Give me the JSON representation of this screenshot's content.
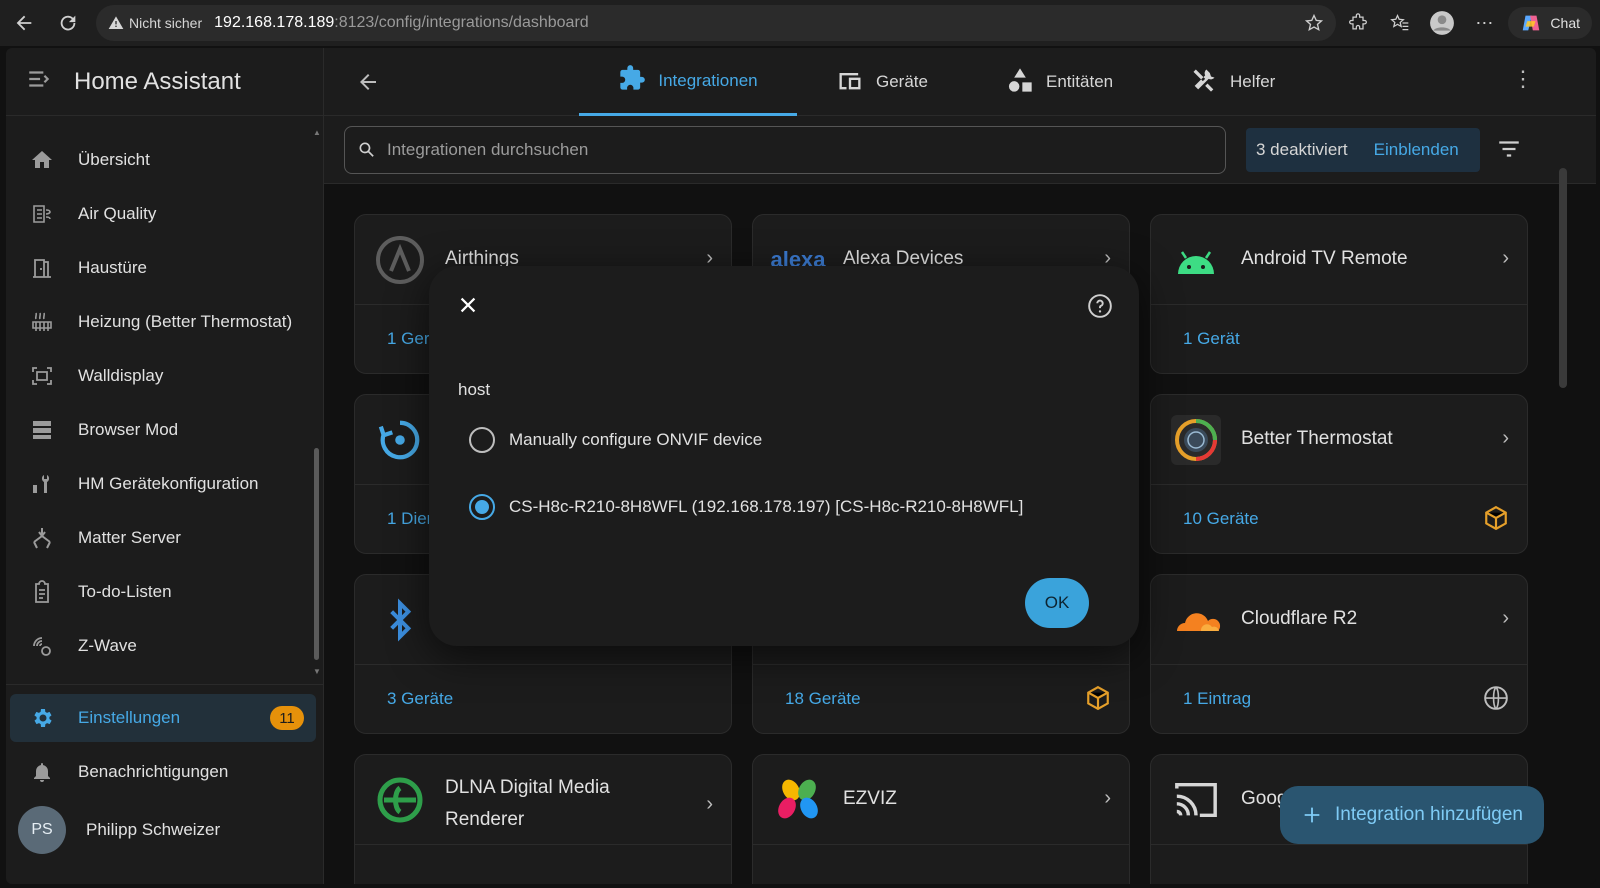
{
  "browser": {
    "not_secure": "Nicht sicher",
    "url_host": "192.168.178.189",
    "url_path": ":8123/config/integrations/dashboard",
    "chat": "Chat"
  },
  "sidebar": {
    "title": "Home Assistant",
    "items": [
      {
        "label": "Übersicht",
        "icon": "home-icon"
      },
      {
        "label": "Air Quality",
        "icon": "air-quality-icon"
      },
      {
        "label": "Haustüre",
        "icon": "door-icon"
      },
      {
        "label": "Heizung (Better Thermostat)",
        "icon": "radiator-icon"
      },
      {
        "label": "Walldisplay",
        "icon": "display-icon"
      },
      {
        "label": "Browser Mod",
        "icon": "server-icon"
      },
      {
        "label": "HM Gerätekonfiguration",
        "icon": "tools-icon"
      },
      {
        "label": "Matter Server",
        "icon": "matter-icon"
      },
      {
        "label": "To-do-Listen",
        "icon": "clipboard-icon"
      },
      {
        "label": "Z-Wave",
        "icon": "zwave-icon"
      }
    ],
    "settings": {
      "label": "Einstellungen",
      "badge": "11"
    },
    "notifications": "Benachrichtigungen",
    "user": {
      "initials": "PS",
      "name": "Philipp Schweizer"
    }
  },
  "tabs": [
    {
      "label": "Integrationen",
      "icon": "puzzle-icon"
    },
    {
      "label": "Geräte",
      "icon": "devices-icon"
    },
    {
      "label": "Entitäten",
      "icon": "shapes-icon"
    },
    {
      "label": "Helfer",
      "icon": "tools-icon"
    }
  ],
  "search": {
    "placeholder": "Integrationen durchsuchen",
    "disabled_count": "3 deaktiviert",
    "show": "Einblenden"
  },
  "cards": [
    {
      "name": "Airthings",
      "foot": "1 Gerä"
    },
    {
      "name": "Alexa Devices",
      "foot": ""
    },
    {
      "name": "Android TV Remote",
      "foot": "1 Gerät"
    },
    {
      "name": "",
      "foot": "1 Dien"
    },
    {
      "name": "Better Thermostat",
      "foot": "10 Geräte"
    },
    {
      "name": "",
      "foot": "3 Geräte"
    },
    {
      "name": "",
      "foot": "18 Geräte"
    },
    {
      "name": "Cloudflare R2",
      "foot": "1 Eintrag"
    },
    {
      "name_line1": "DLNA Digital Media",
      "name_line2": "Renderer"
    },
    {
      "name": "EZVIZ"
    },
    {
      "name": "Googl"
    }
  ],
  "alexa_logo": "alexa",
  "fab": {
    "label": "Integration hinzufügen"
  },
  "dialog": {
    "field_label": "host",
    "options": [
      {
        "label": "Manually configure ONVIF device",
        "selected": false
      },
      {
        "label": "CS-H8c-R210-8H8WFL (192.168.178.197) [CS-H8c-R210-8H8WFL]",
        "selected": true
      }
    ],
    "ok": "OK"
  },
  "colors": {
    "accent": "#46a9e6",
    "badge": "#e6910a",
    "background": "#111111",
    "card": "#1c1c1c"
  }
}
